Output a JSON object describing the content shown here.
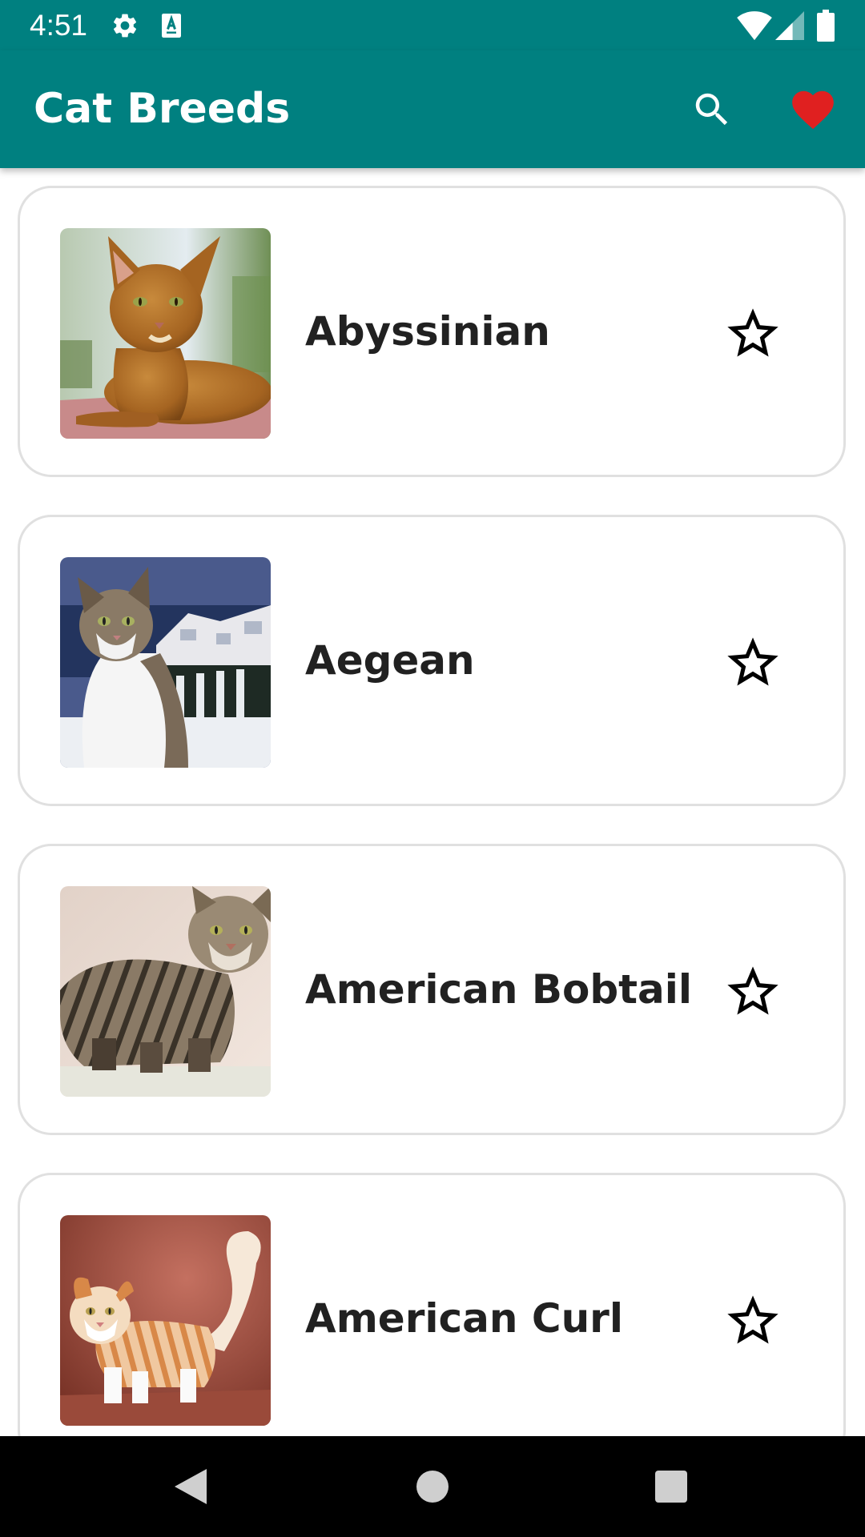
{
  "status_bar": {
    "time": "4:51",
    "left_icons": [
      "gear-icon",
      "keyboard-a-icon"
    ],
    "right_icons": [
      "wifi-icon",
      "cellular-signal-icon",
      "battery-icon"
    ]
  },
  "app_bar": {
    "title": "Cat Breeds",
    "actions": [
      "search-icon",
      "heart-icon"
    ]
  },
  "colors": {
    "primary": "#008080",
    "favorite_heart": "#e02020",
    "card_border": "#e0e0e0",
    "text": "#212121"
  },
  "breeds": [
    {
      "name": "Abyssinian",
      "favorite": false,
      "image": "abyssinian-cat-photo"
    },
    {
      "name": "Aegean",
      "favorite": false,
      "image": "aegean-cat-photo"
    },
    {
      "name": "American Bobtail",
      "favorite": false,
      "image": "american-bobtail-cat-photo"
    },
    {
      "name": "American Curl",
      "favorite": false,
      "image": "american-curl-cat-photo"
    }
  ],
  "nav_bar": {
    "buttons": [
      "back-icon",
      "home-icon",
      "recents-icon"
    ]
  }
}
